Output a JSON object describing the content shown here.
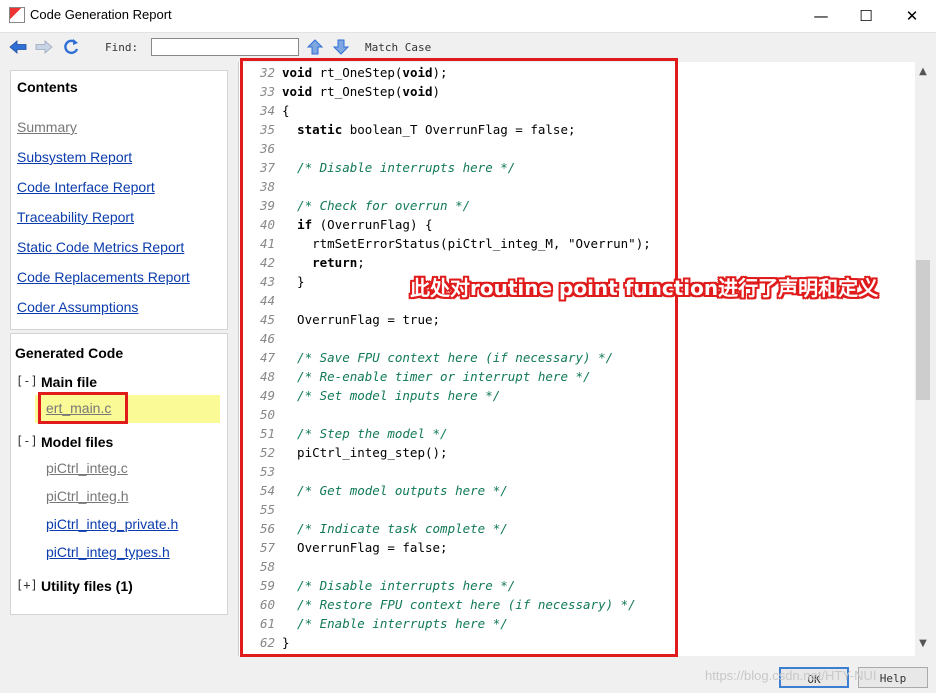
{
  "window": {
    "title": "Code Generation Report",
    "minimize": "—",
    "maximize": "☐",
    "close": "✕"
  },
  "toolbar": {
    "find_label": "Find:",
    "find_value": "",
    "match_case_label": "Match Case"
  },
  "contents": {
    "heading": "Contents",
    "links": [
      {
        "label": "Summary"
      },
      {
        "label": "Subsystem Report"
      },
      {
        "label": "Code Interface Report"
      },
      {
        "label": "Traceability Report"
      },
      {
        "label": "Static Code Metrics Report"
      },
      {
        "label": "Code Replacements Report"
      },
      {
        "label": "Coder Assumptions"
      }
    ]
  },
  "generated": {
    "heading": "Generated Code",
    "main_toggle": "[-]",
    "main_label": "Main file",
    "main_file": "ert_main.c",
    "model_toggle": "[-]",
    "model_label": "Model files",
    "model_files": [
      "piCtrl_integ.c",
      "piCtrl_integ.h",
      "piCtrl_integ_private.h",
      "piCtrl_integ_types.h"
    ],
    "utility_toggle": "[+]",
    "utility_label": "Utility files (1)"
  },
  "code": {
    "lines": [
      {
        "n": "32",
        "text": "void rt_OneStep(void);",
        "type": "code"
      },
      {
        "n": "33",
        "text": "void rt_OneStep(void)",
        "type": "code"
      },
      {
        "n": "34",
        "text": "{",
        "type": "code"
      },
      {
        "n": "35",
        "text": "  static boolean_T OverrunFlag = false;",
        "type": "code"
      },
      {
        "n": "36",
        "text": "",
        "type": "code"
      },
      {
        "n": "37",
        "text": "  /* Disable interrupts here */",
        "type": "comment"
      },
      {
        "n": "38",
        "text": "",
        "type": "code"
      },
      {
        "n": "39",
        "text": "  /* Check for overrun */",
        "type": "comment"
      },
      {
        "n": "40",
        "text": "  if (OverrunFlag) {",
        "type": "code"
      },
      {
        "n": "41",
        "text": "    rtmSetErrorStatus(piCtrl_integ_M, \"Overrun\");",
        "type": "code"
      },
      {
        "n": "42",
        "text": "    return;",
        "type": "code"
      },
      {
        "n": "43",
        "text": "  }",
        "type": "code"
      },
      {
        "n": "44",
        "text": "",
        "type": "code"
      },
      {
        "n": "45",
        "text": "  OverrunFlag = true;",
        "type": "code"
      },
      {
        "n": "46",
        "text": "",
        "type": "code"
      },
      {
        "n": "47",
        "text": "  /* Save FPU context here (if necessary) */",
        "type": "comment"
      },
      {
        "n": "48",
        "text": "  /* Re-enable timer or interrupt here */",
        "type": "comment"
      },
      {
        "n": "49",
        "text": "  /* Set model inputs here */",
        "type": "comment"
      },
      {
        "n": "50",
        "text": "",
        "type": "code"
      },
      {
        "n": "51",
        "text": "  /* Step the model */",
        "type": "comment"
      },
      {
        "n": "52",
        "text": "  piCtrl_integ_step();",
        "type": "code"
      },
      {
        "n": "53",
        "text": "",
        "type": "code"
      },
      {
        "n": "54",
        "text": "  /* Get model outputs here */",
        "type": "comment"
      },
      {
        "n": "55",
        "text": "",
        "type": "code"
      },
      {
        "n": "56",
        "text": "  /* Indicate task complete */",
        "type": "comment"
      },
      {
        "n": "57",
        "text": "  OverrunFlag = false;",
        "type": "code"
      },
      {
        "n": "58",
        "text": "",
        "type": "code"
      },
      {
        "n": "59",
        "text": "  /* Disable interrupts here */",
        "type": "comment"
      },
      {
        "n": "60",
        "text": "  /* Restore FPU context here (if necessary) */",
        "type": "comment"
      },
      {
        "n": "61",
        "text": "  /* Enable interrupts here */",
        "type": "comment"
      },
      {
        "n": "62",
        "text": "}",
        "type": "code"
      }
    ]
  },
  "annotation": "此处对routine point function进行了声明和定义",
  "buttons": {
    "ok": "OK",
    "help": "Help"
  },
  "watermark": "https://blog.csdn.net/HTY-NUI",
  "colors": {
    "highlight": "#fafa96",
    "annotation_red": "#e01b1b",
    "link": "#0b3cad",
    "comment": "#117a55"
  }
}
